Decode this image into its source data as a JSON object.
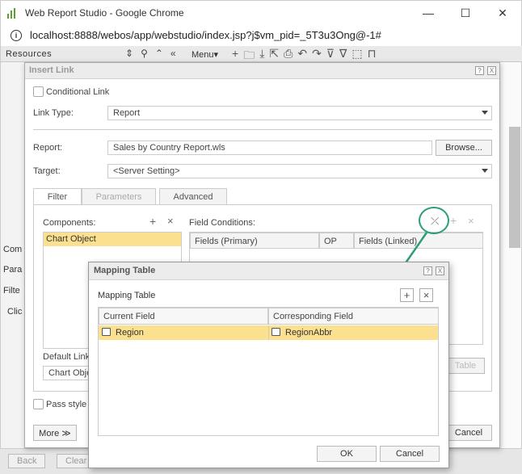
{
  "browser": {
    "title": "Web Report Studio - Google Chrome",
    "url": "localhost:8888/webos/app/webstudio/index.jsp?j$vm_pid=_5T3u3Ong@-1#",
    "minimize": "—",
    "maximize": "☐",
    "close": "✕"
  },
  "app": {
    "resources_label": "Resources",
    "menu_label": "Menu▾",
    "left_labels": [
      "Com",
      "Para",
      "Filte",
      "Clic"
    ],
    "back_label": "Back",
    "clear_label": "Clear"
  },
  "insert_link": {
    "title": "Insert Link",
    "help": "?",
    "close": "X",
    "conditional_link": "Conditional Link",
    "link_type_label": "Link Type:",
    "link_type_value": "Report",
    "report_label": "Report:",
    "report_value": "Sales by Country Report.wls",
    "browse": "Browse...",
    "target_label": "Target:",
    "target_value": "<Server Setting>",
    "tabs": [
      {
        "label": "Filter"
      },
      {
        "label": "Parameters"
      },
      {
        "label": "Advanced"
      }
    ],
    "components_label": "Components:",
    "components_items": [
      "Chart Object"
    ],
    "field_conditions_label": "Field Conditions:",
    "grid_headers": [
      "Fields (Primary)",
      "OP",
      "Fields (Linked)"
    ],
    "default_link_label": "Default Link",
    "default_link_value": "Chart Obje",
    "table_btn": "Table",
    "pass_style": "Pass style",
    "more": "More ≫",
    "cancel": "Cancel"
  },
  "mapping": {
    "title": "Mapping Table",
    "help": "?",
    "close": "X",
    "heading": "Mapping Table",
    "add": "+",
    "delete": "×",
    "headers": [
      "Current Field",
      "Corresponding Field"
    ],
    "rows": [
      {
        "current": "Region",
        "corresponding": "RegionAbbr"
      }
    ],
    "ok": "OK",
    "cancel": "Cancel"
  },
  "colors": {
    "selection": "#fbe18f",
    "annotation": "#2a9d7b"
  }
}
